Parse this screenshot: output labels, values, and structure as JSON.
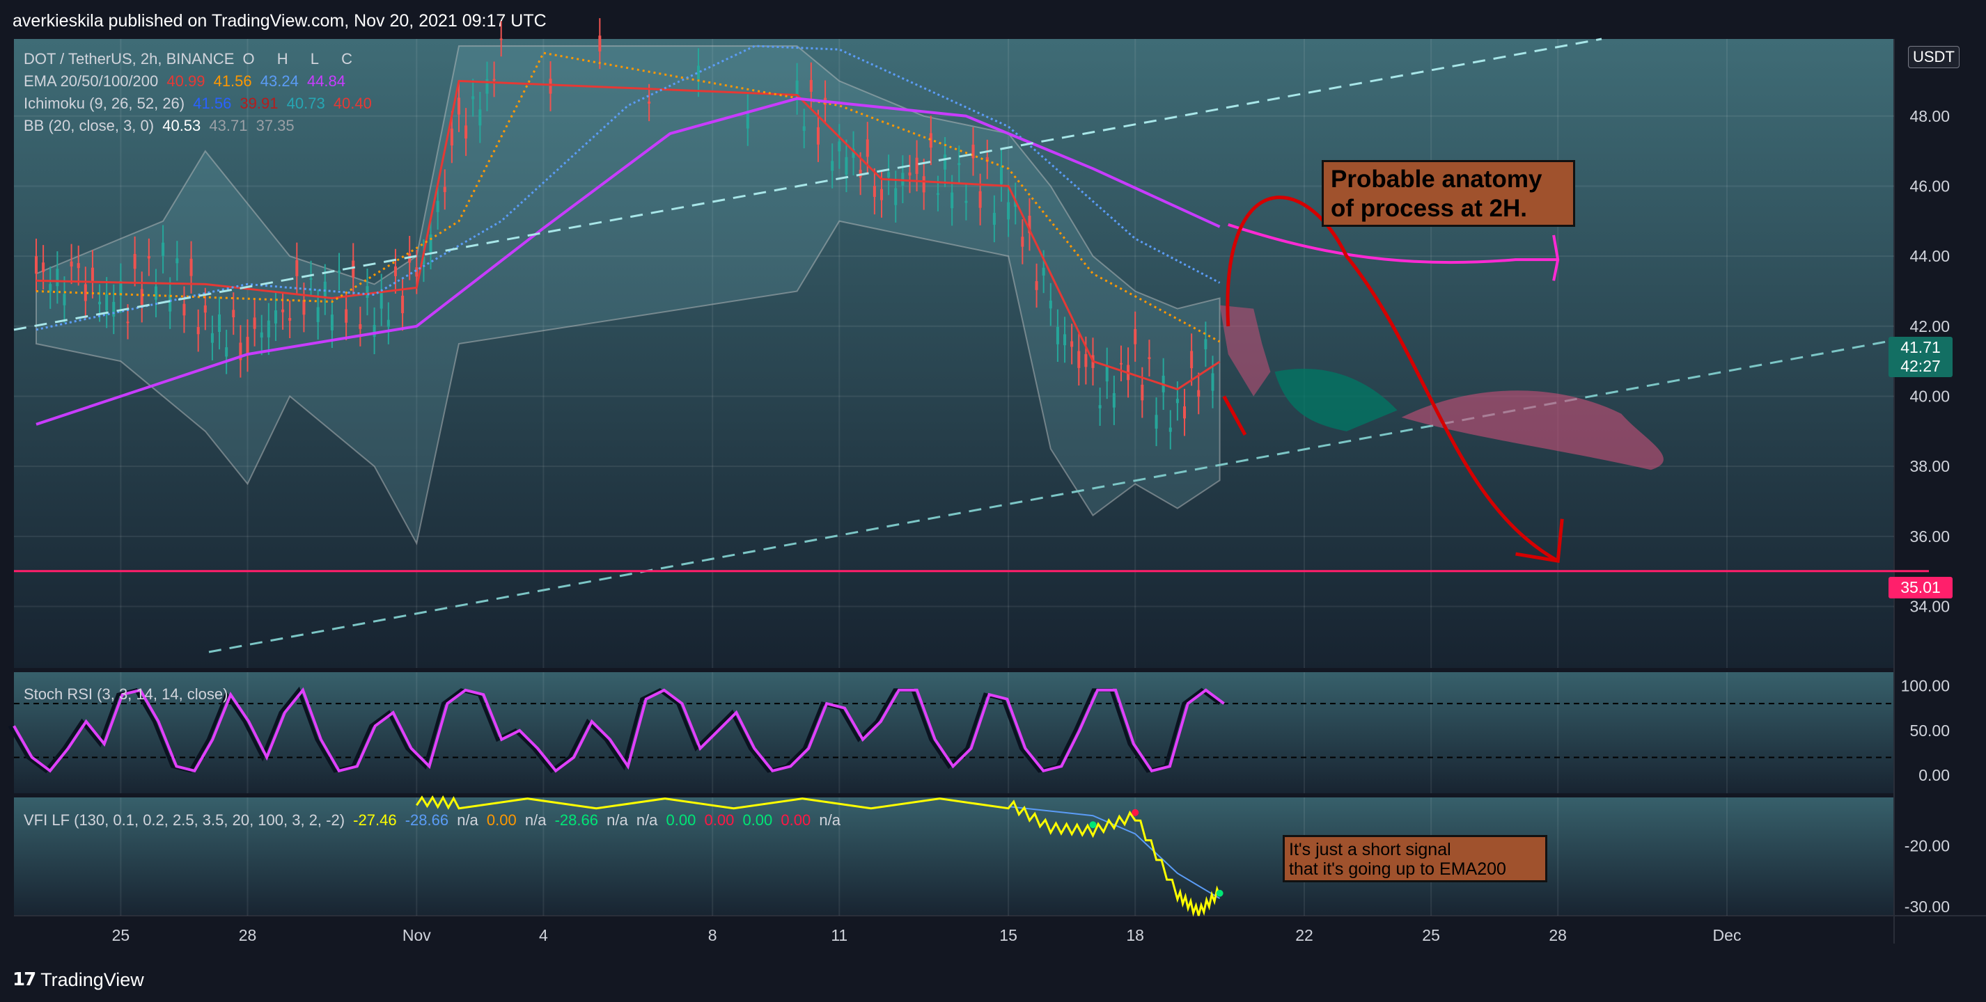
{
  "header": {
    "publisher_line": "averkieskila published on TradingView.com, Nov 20, 2021 09:17 UTC"
  },
  "footer": {
    "brand": "TradingView",
    "brand_mark": "17"
  },
  "currency_button": "USDT",
  "main_legend": {
    "symbol": "DOT / TetherUS, 2h, BINANCE",
    "ohlc_labels": [
      "O",
      "H",
      "L",
      "C"
    ],
    "ema_label": "EMA 20/50/100/200",
    "ema_values": [
      "40.99",
      "41.56",
      "43.24",
      "44.84"
    ],
    "ichimoku_label": "Ichimoku (9, 26, 52, 26)",
    "ichimoku_values": [
      "41.56",
      "39.91",
      "40.73",
      "40.40"
    ],
    "bb_label": "BB (20, close, 3, 0)",
    "bb_values": [
      "40.53",
      "43.71",
      "37.35"
    ]
  },
  "stoch_legend": {
    "label": "Stoch RSI (3, 3, 14, 14, close)"
  },
  "vfi_legend": {
    "label": "VFI LF (130, 0.1, 0.2, 2.5, 3.5, 20, 100, 3, 2, -2)",
    "values": [
      "-27.46",
      "-28.66",
      "n/a",
      "0.00",
      "n/a",
      "-28.66",
      "n/a",
      "n/a",
      "0.00",
      "0.00",
      "0.00",
      "0.00",
      "n/a"
    ]
  },
  "price_labels": {
    "last_price": "41.71",
    "countdown": "42:27",
    "level": "35.01"
  },
  "annotations": {
    "main_note_line1": "Probable anatomy",
    "main_note_line2": "of process at 2H.",
    "vfi_note_line1": "It's just a short signal",
    "vfi_note_line2": "that it's going up to EMA200"
  },
  "colors": {
    "background": "#131722",
    "ema20": "#e53935",
    "ema50": "#ff9800",
    "ema100": "#5b9cf6",
    "ema200": "#c83cff",
    "level_line": "#ff1f6b",
    "stoch_k": "#e040fb",
    "vfi": "#ffff00",
    "vfi_signal": "#5b9cf6",
    "note_bg": "#a0522d",
    "forecast_arrow": "#d50000",
    "forecast_path_ema200": "#ff2ad4"
  },
  "chart_data": [
    {
      "type": "line",
      "title": "DOT / TetherUS, 2h, BINANCE",
      "x_ticks": [
        "25",
        "28",
        "Nov",
        "4",
        "8",
        "11",
        "15",
        "18",
        "22",
        "25",
        "28",
        "Dec"
      ],
      "y_ticks": [
        34,
        36,
        38,
        40,
        42,
        44,
        46,
        48
      ],
      "ylim": [
        32.7,
        50.2
      ],
      "grid": true,
      "series": [
        {
          "name": "EMA 20/50/100/200",
          "values": [
            {
              "x": "Oct 23",
              "y": 43.3
            },
            {
              "x": "Oct 27",
              "y": 43.2
            },
            {
              "x": "Oct 30",
              "y": 42.8
            },
            {
              "x": "Nov 1",
              "y": 43.1
            },
            {
              "x": "Nov 2",
              "y": 49.0
            },
            {
              "x": "Nov 10",
              "y": 48.6
            },
            {
              "x": "Nov 12",
              "y": 46.2
            },
            {
              "x": "Nov 15",
              "y": 46.0
            },
            {
              "x": "Nov 16",
              "y": 43.5
            },
            {
              "x": "Nov 17",
              "y": 41.0
            },
            {
              "x": "Nov 19",
              "y": 40.2
            },
            {
              "x": "Nov 20",
              "y": 40.99
            }
          ]
        },
        {
          "name": "EMA 50",
          "values": [
            {
              "x": "Oct 23",
              "y": 43.0
            },
            {
              "x": "Oct 30",
              "y": 42.7
            },
            {
              "x": "Nov 2",
              "y": 45.0
            },
            {
              "x": "Nov 4",
              "y": 49.8
            },
            {
              "x": "Nov 11",
              "y": 48.3
            },
            {
              "x": "Nov 15",
              "y": 46.5
            },
            {
              "x": "Nov 17",
              "y": 43.5
            },
            {
              "x": "Nov 20",
              "y": 41.56
            }
          ]
        },
        {
          "name": "EMA 100",
          "values": [
            {
              "x": "Oct 23",
              "y": 41.9
            },
            {
              "x": "Oct 28",
              "y": 43.2
            },
            {
              "x": "Oct 31",
              "y": 42.9
            },
            {
              "x": "Nov 3",
              "y": 45.0
            },
            {
              "x": "Nov 6",
              "y": 48.3
            },
            {
              "x": "Nov 9",
              "y": 50.0
            },
            {
              "x": "Nov 11",
              "y": 49.9
            },
            {
              "x": "Nov 15",
              "y": 47.7
            },
            {
              "x": "Nov 18",
              "y": 44.5
            },
            {
              "x": "Nov 20",
              "y": 43.24
            }
          ]
        },
        {
          "name": "EMA 200",
          "values": [
            {
              "x": "Oct 23",
              "y": 39.2
            },
            {
              "x": "Oct 28",
              "y": 41.2
            },
            {
              "x": "Nov 1",
              "y": 42.0
            },
            {
              "x": "Nov 4",
              "y": 44.8
            },
            {
              "x": "Nov 7",
              "y": 47.5
            },
            {
              "x": "Nov 10",
              "y": 48.5
            },
            {
              "x": "Nov 14",
              "y": 48.0
            },
            {
              "x": "Nov 17",
              "y": 46.5
            },
            {
              "x": "Nov 20",
              "y": 44.84
            }
          ]
        },
        {
          "name": "Level 35.01",
          "values": [
            {
              "x": "Oct 23",
              "y": 35.01
            },
            {
              "x": "Dec 4",
              "y": 35.01
            }
          ]
        }
      ]
    },
    {
      "type": "line",
      "title": "Stoch RSI (3, 3, 14, 14, close)",
      "y_ticks": [
        0,
        50,
        100
      ],
      "ylim": [
        -20,
        115
      ],
      "levels": [
        80,
        20
      ],
      "series": [
        {
          "name": "Stoch RSI (3, 3, 14, 14, close)",
          "values": [
            55,
            20,
            5,
            30,
            60,
            35,
            90,
            95,
            60,
            10,
            5,
            40,
            90,
            60,
            20,
            70,
            95,
            40,
            5,
            10,
            55,
            70,
            30,
            10,
            80,
            95,
            90,
            40,
            50,
            30,
            5,
            20,
            60,
            40,
            10,
            85,
            95,
            80,
            30,
            50,
            70,
            30,
            5,
            10,
            30,
            80,
            75,
            40,
            60,
            95,
            95,
            40,
            10,
            30,
            90,
            85,
            30,
            5,
            10,
            50,
            95,
            95,
            35,
            5,
            10,
            80,
            95,
            80
          ]
        }
      ]
    },
    {
      "type": "line",
      "title": "VFI LF (130, 0.1, 0.2, 2.5, 3.5, 20, 100, 3, 2, -2)",
      "y_ticks": [
        -20,
        -30
      ],
      "ylim": [
        -31.5,
        -12
      ],
      "series": [
        {
          "name": "VFI",
          "values": [
            {
              "x": "Nov 1",
              "y": -12.5
            },
            {
              "x": "Nov 2",
              "y": -13
            },
            {
              "x": "Nov 15",
              "y": -13
            },
            {
              "x": "Nov 16",
              "y": -17
            },
            {
              "x": "Nov 17",
              "y": -17.5
            },
            {
              "x": "Nov 18",
              "y": -15
            },
            {
              "x": "Nov 19",
              "y": -28
            },
            {
              "x": "Nov 19.5",
              "y": -31
            },
            {
              "x": "Nov 20",
              "y": -27.46
            }
          ]
        },
        {
          "name": "Signal",
          "values": [
            {
              "x": "Nov 15",
              "y": -13.5
            },
            {
              "x": "Nov 17",
              "y": -15
            },
            {
              "x": "Nov 18",
              "y": -18
            },
            {
              "x": "Nov 19",
              "y": -24.5
            },
            {
              "x": "Nov 20",
              "y": -28.66
            }
          ]
        }
      ]
    }
  ]
}
